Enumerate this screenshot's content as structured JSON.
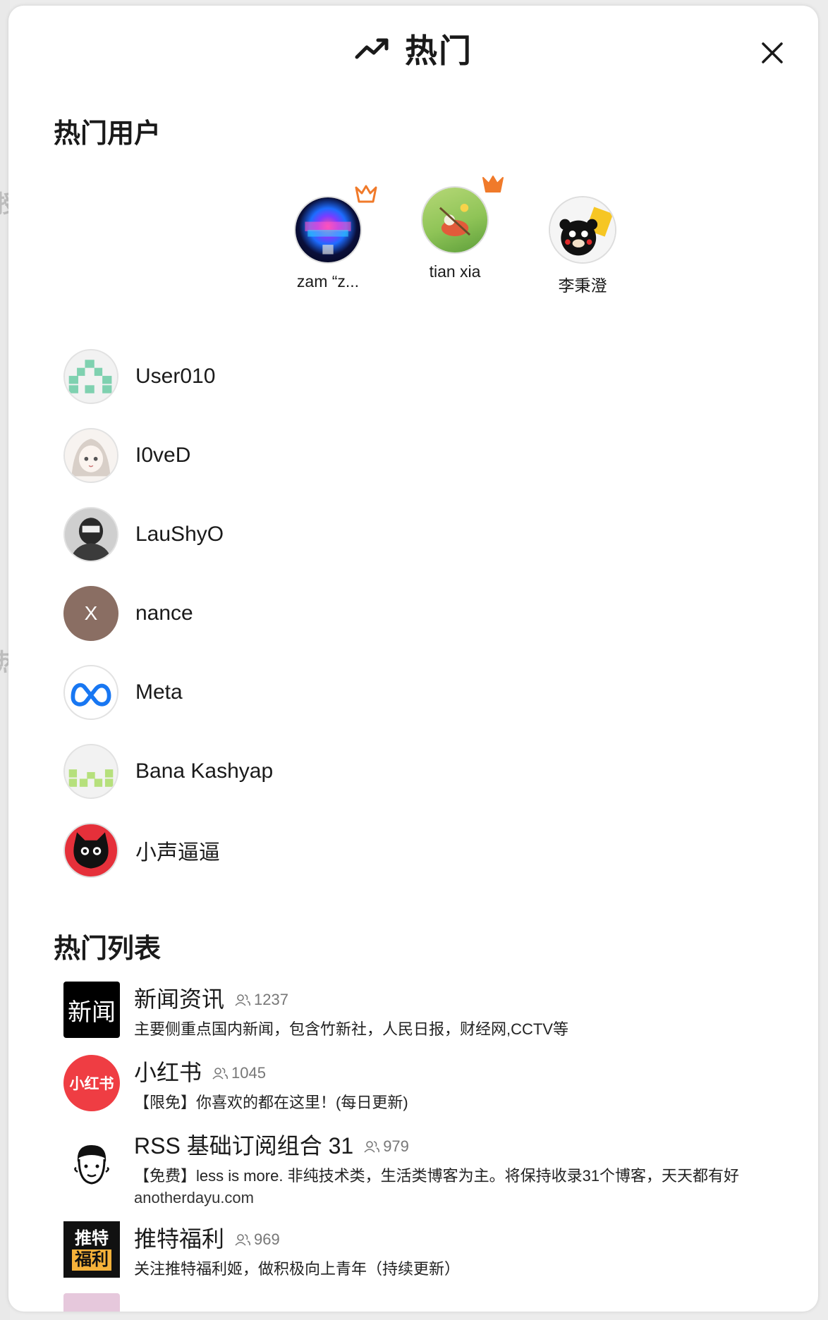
{
  "header": {
    "title": "热门"
  },
  "sections": {
    "users_title": "热门用户",
    "lists_title": "热门列表"
  },
  "podium": [
    {
      "name": "zam “z...",
      "rank_icon": "crown-outline-icon"
    },
    {
      "name": "tian xia",
      "rank_icon": "crown-filled-icon"
    },
    {
      "name": "李秉澄"
    }
  ],
  "users": [
    {
      "name": "User010"
    },
    {
      "name": "I0veD"
    },
    {
      "name": "LauShyO"
    },
    {
      "name": "nance",
      "initial": "X"
    },
    {
      "name": "Meta"
    },
    {
      "name": "Bana Kashyap"
    },
    {
      "name": "小声逼逼"
    }
  ],
  "lists": [
    {
      "title": "新闻资讯",
      "count": "1237",
      "desc": "主要侧重点国内新闻，包含竹新社，人民日报，财经网,CCTV等",
      "thumb_text": "新闻"
    },
    {
      "title": "小红书",
      "count": "1045",
      "desc": "【限免】你喜欢的都在这里！(每日更新)",
      "thumb_text": "小红书"
    },
    {
      "title": "RSS 基础订阅组合 31",
      "count": "979",
      "desc": "【免费】less is more. 非纯技术类，生活类博客为主。将保持收录31个博客，天天都有好",
      "sub": "anotherdayu.com"
    },
    {
      "title": "推特福利",
      "count": "969",
      "desc": "关注推特福利姬，做积极向上青年（持续更新）",
      "thumb_text_1": "推特",
      "thumb_text_2": "福利"
    }
  ],
  "colors": {
    "accent_orange": "#f07a2a",
    "nance_avatar": "#8a6e63",
    "xhs_red": "#ef3d43"
  }
}
